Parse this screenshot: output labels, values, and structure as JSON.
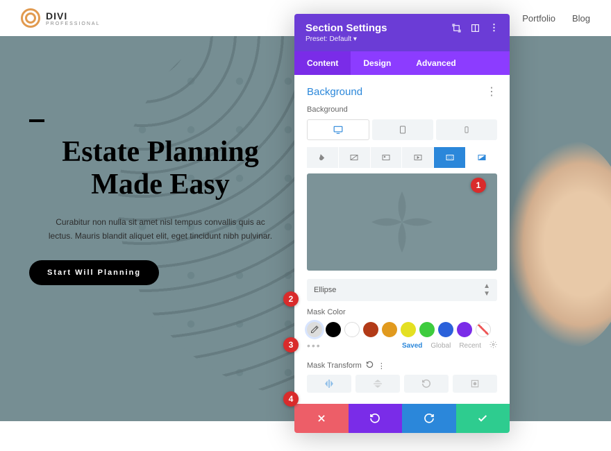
{
  "nav": {
    "brand": "DIVI",
    "brand_sub": "PROFESSIONAL",
    "links": [
      "Portfolio",
      "Blog"
    ]
  },
  "hero": {
    "title_line1": "Estate Planning",
    "title_line2": "Made Easy",
    "desc": "Curabitur non nulla sit amet nisl tempus convallis quis ac lectus. Mauris blandit aliquet elit, eget tincidunt nibh pulvinar.",
    "cta": "Start Will Planning"
  },
  "panel": {
    "title": "Section Settings",
    "preset": "Preset: Default ▾",
    "tabs": {
      "content": "Content",
      "design": "Design",
      "advanced": "Advanced"
    },
    "section_title": "Background",
    "sub_background": "Background",
    "mask_select": "Ellipse",
    "mask_color_label": "Mask Color",
    "palette_tabs": {
      "saved": "Saved",
      "global": "Global",
      "recent": "Recent"
    },
    "mask_transform_label": "Mask Transform",
    "swatches": [
      "#000000",
      "#ffffff",
      "#b23a17",
      "#e19a1e",
      "#e4e022",
      "#3ecc3e",
      "#2b61da",
      "#7a2ce8"
    ],
    "swatch_disabled": true
  },
  "callouts": [
    "1",
    "2",
    "3",
    "4"
  ]
}
